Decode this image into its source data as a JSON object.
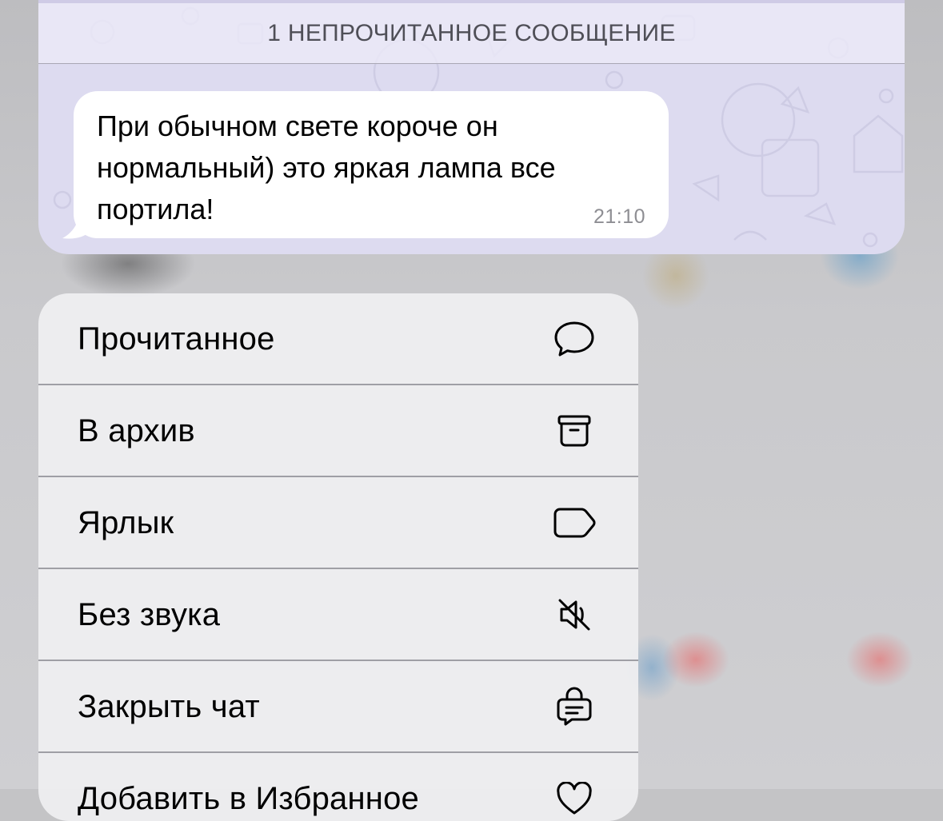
{
  "chat": {
    "unread_label": "1 НЕПРОЧИТАННОЕ СООБЩЕНИЕ",
    "message": {
      "text": "При обычном свете короче он нормальный) это яркая лампа все портила!",
      "time": "21:10"
    }
  },
  "menu": {
    "items": [
      {
        "label": "Прочитанное",
        "icon": "message-bubble-icon"
      },
      {
        "label": "В архив",
        "icon": "archive-box-icon"
      },
      {
        "label": "Ярлык",
        "icon": "tag-icon"
      },
      {
        "label": "Без звука",
        "icon": "speaker-muted-icon"
      },
      {
        "label": "Закрыть чат",
        "icon": "lock-chat-icon"
      },
      {
        "label": "Добавить в Избранное",
        "icon": "heart-icon"
      }
    ]
  },
  "colors": {
    "chat_background": "#dddbf0",
    "bubble": "#ffffff",
    "menu_background": "#ededf0",
    "timestamp": "#8e8e93"
  }
}
